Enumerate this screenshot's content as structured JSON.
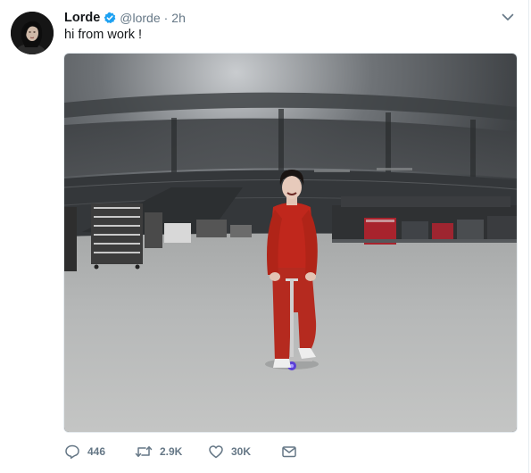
{
  "tweet": {
    "display_name": "Lorde",
    "handle": "@lorde",
    "separator": "·",
    "time": "2h",
    "text": "hi from work !",
    "verified": true
  },
  "actions": {
    "reply_count": "446",
    "retweet_count": "2.9K",
    "like_count": "30K"
  },
  "icons": {
    "verified": "verified-badge-icon",
    "menu": "chevron-down-icon",
    "reply": "reply-icon",
    "retweet": "retweet-icon",
    "like": "heart-icon",
    "message": "envelope-icon"
  },
  "colors": {
    "accent": "#1da1f2",
    "text": "#14171a",
    "muted": "#657786",
    "jumpsuit": "#c0271c"
  }
}
